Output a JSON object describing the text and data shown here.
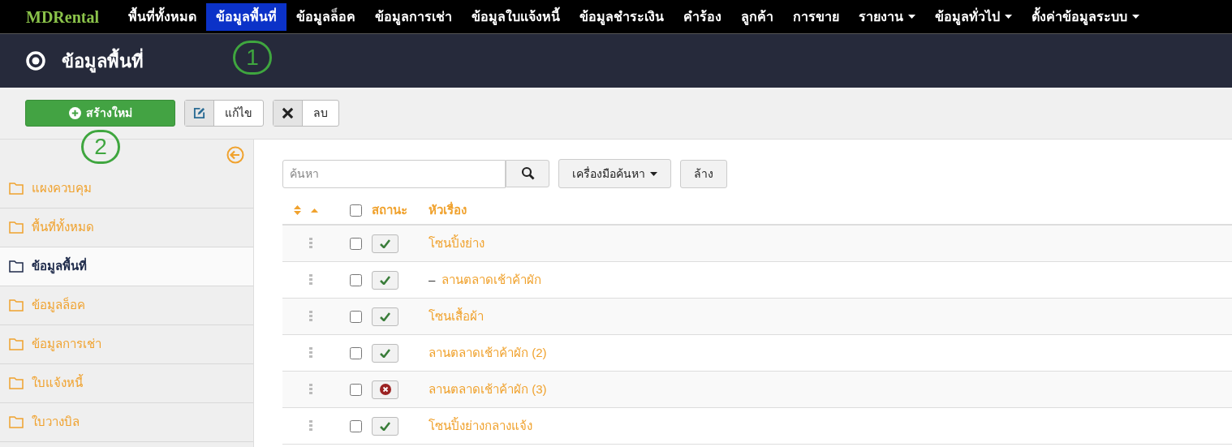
{
  "navbar": {
    "brand": "MDRental",
    "items": [
      {
        "label": "พื้นที่ทั้งหมด",
        "selected": false,
        "dropdown": false
      },
      {
        "label": "ข้อมูลพื้นที่",
        "selected": true,
        "dropdown": false
      },
      {
        "label": "ข้อมูลล็อค",
        "selected": false,
        "dropdown": false
      },
      {
        "label": "ข้อมูลการเช่า",
        "selected": false,
        "dropdown": false
      },
      {
        "label": "ข้อมูลใบแจ้งหนี้",
        "selected": false,
        "dropdown": false
      },
      {
        "label": "ข้อมูลชำระเงิน",
        "selected": false,
        "dropdown": false
      },
      {
        "label": "คำร้อง",
        "selected": false,
        "dropdown": false
      },
      {
        "label": "ลูกค้า",
        "selected": false,
        "dropdown": false
      },
      {
        "label": "การขาย",
        "selected": false,
        "dropdown": false
      },
      {
        "label": "รายงาน",
        "selected": false,
        "dropdown": true
      },
      {
        "label": "ข้อมูลทั่วไป",
        "selected": false,
        "dropdown": true
      },
      {
        "label": "ตั้งค่าข้อมูลระบบ",
        "selected": false,
        "dropdown": true
      }
    ]
  },
  "page_title": "ข้อมูลพื้นที่",
  "callouts": [
    "1",
    "2"
  ],
  "toolbar": [
    {
      "kind": "new",
      "label": "สร้างใหม่"
    },
    {
      "kind": "edit",
      "label": "แก้ไข"
    },
    {
      "kind": "delete",
      "label": "ลบ"
    }
  ],
  "sidebar": {
    "items": [
      {
        "label": "แผงควบคุม",
        "selected": false
      },
      {
        "label": "พื้นที่ทั้งหมด",
        "selected": false
      },
      {
        "label": "ข้อมูลพื้นที่",
        "selected": true
      },
      {
        "label": "ข้อมูลล็อค",
        "selected": false
      },
      {
        "label": "ข้อมูลการเช่า",
        "selected": false
      },
      {
        "label": "ใบแจ้งหนี้",
        "selected": false
      },
      {
        "label": "ใบวางบิล",
        "selected": false
      }
    ]
  },
  "search": {
    "placeholder": "ค้นหา",
    "tools_button": "เครื่องมือค้นหา",
    "clear_button": "ล้าง"
  },
  "table": {
    "columns": [
      "สถานะ",
      "หัวเรื่อง"
    ],
    "select_all_checked": false,
    "rows": [
      {
        "title": "โซนปิ้งย่าง",
        "published": true,
        "checked": false,
        "children": [
          {
            "marker": "–",
            "title": "ลานตลาดเช้าค้าผัก",
            "published": true,
            "checked": false
          }
        ]
      },
      {
        "title": "โซนเสื้อผ้า",
        "published": true,
        "checked": false
      },
      {
        "title": "ลานตลาดเช้าค้าผัก (2)",
        "published": true,
        "checked": false
      },
      {
        "title": "ลานตลาดเช้าค้าผัก (3)",
        "published": false,
        "checked": false
      },
      {
        "title": "โซนปิ้งย่างกลางแจ้ง",
        "published": true,
        "checked": false
      }
    ]
  }
}
